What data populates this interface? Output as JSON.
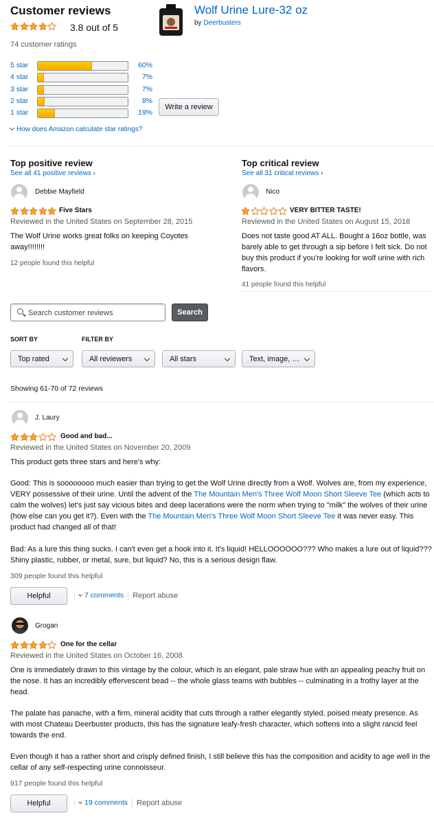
{
  "header": {
    "title": "Customer reviews",
    "rating_text": "3.8 out of 5",
    "rating_value": 3.8,
    "ratings_count": "74 customer ratings",
    "product_name": "Wolf Urine Lure-32 oz",
    "by_label": "by",
    "brand": "Deerbusters"
  },
  "histogram": [
    {
      "label": "5 star",
      "percent_text": "60%",
      "percent": 60
    },
    {
      "label": "4 star",
      "percent_text": "7%",
      "percent": 7
    },
    {
      "label": "3 star",
      "percent_text": "7%",
      "percent": 7
    },
    {
      "label": "2 star",
      "percent_text": "8%",
      "percent": 8
    },
    {
      "label": "1 star",
      "percent_text": "19%",
      "percent": 19
    }
  ],
  "write_review_label": "Write a review",
  "how_calculated": "How does Amazon calculate star ratings?",
  "top_positive": {
    "heading": "Top positive review",
    "see_all": "See all 41 positive reviews",
    "reviewer": "Debbie Mayfield",
    "stars": 5,
    "title": "Five Stars",
    "date": "Reviewed in the United States on September 28, 2015",
    "body": "The Wolf Urine works great folks on keeping Coyotes away!!!!!!!!",
    "helpful": "12 people found this helpful"
  },
  "top_critical": {
    "heading": "Top critical review",
    "see_all": "See all 31 critical reviews",
    "reviewer": "Nico",
    "stars": 1,
    "title": "VERY BITTER TASTE!",
    "date": "Reviewed in the United States on August 15, 2018",
    "body": "Does not taste good AT ALL. Bought a 16oz bottle, was barely able to get through a sip before I felt sick. Do not buy this product if you're looking for wolf urine with rich flavors.",
    "helpful": "41 people found this helpful"
  },
  "search": {
    "placeholder": "Search customer reviews",
    "button": "Search"
  },
  "sort_label": "SORT BY",
  "filter_label": "FILTER BY",
  "dropdowns": {
    "sort": "Top rated",
    "reviewers": "All reviewers",
    "stars": "All stars",
    "format": "Text, image, …"
  },
  "showing": "Showing 61-70 of 72 reviews",
  "reviews": [
    {
      "reviewer": "J. Laury",
      "stars": 3,
      "title": "Good and bad...",
      "date": "Reviewed in the United States on November 20, 2009",
      "p1": "This product gets three stars and here's why:",
      "p2a": "Good: This is soooooooo much easier than trying to get the Wolf Urine directly from a Wolf. Wolves are, from my experience, VERY possessive of their urine. Until the advent of the ",
      "p2link1": "The Mountain Men's Three Wolf Moon Short Sleeve Tee",
      "p2b": " (which acts to calm the wolves) let's just say vicious bites and deep lacerations were the norm when trying to \"milk\" the wolves of their urine (how else can you get it?). Even with the ",
      "p2link2": "The Mountain Men's Three Wolf Moon Short Sleeve Tee",
      "p2c": " it was never easy. This product had changed all of that!",
      "p3": "Bad: As a lure this thing sucks. I can't even get a hook into it. It's liquid! HELLOOOOOO??? Who makes a lure out of liquid??? Shiny plastic, rubber, or metal, sure, but liquid? No, this is a serious design flaw.",
      "helpful": "309 people found this helpful",
      "helpful_btn": "Helpful",
      "comments": "7 comments",
      "report": "Report abuse"
    },
    {
      "reviewer": "Grogan",
      "stars": 4,
      "title": "One for the cellar",
      "date": "Reviewed in the United States on October 16, 2008",
      "p1": "One is immediately drawn to this vintage by the colour, which is an elegant, pale straw hue with an appealing peachy fruit on the nose. It has an incredibly effervescent bead -- the whole glass teams with bubbles -- culminating in a frothy layer at the head.",
      "p2": "The palate has panache, with a firm, mineral acidity that cuts through a rather elegantly styled, poised meaty presence. As with most Chateau Deerbuster products, this has the signature leafy-fresh character, which softens into a slight rancid feel towards the end.",
      "p3": "Even though it has a rather short and crisply defined finish, I still believe this has the composition and acidity to age well in the cellar of any self-respecting urine connoisseur.",
      "helpful": "917 people found this helpful",
      "helpful_btn": "Helpful",
      "comments": "19 comments",
      "report": "Report abuse"
    }
  ],
  "colors": {
    "star_fill": "#ffa41c",
    "star_stroke": "#de7921",
    "link": "#0066c0",
    "search_button": "#5a5d60"
  }
}
